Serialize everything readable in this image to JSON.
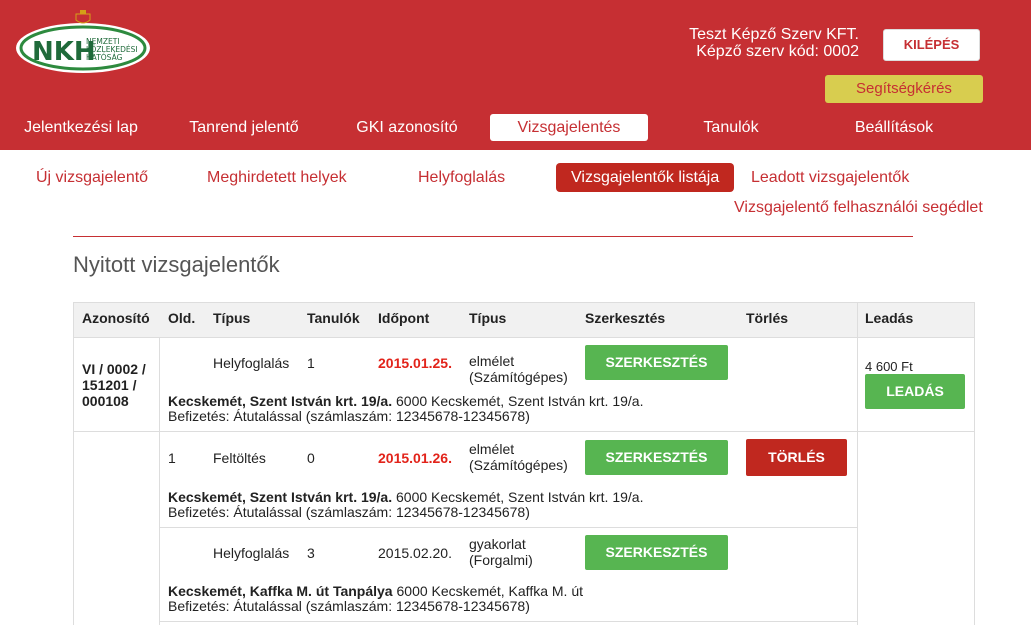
{
  "header": {
    "logo_text": "NKH",
    "logo_subtext": [
      "NEMZETI",
      "KÖZLEKEDÉSI",
      "HATÓSÁG"
    ],
    "org_name": "Teszt Képző Szerv KFT.",
    "org_code": "Képző szerv kód: 0002",
    "logout_label": "KILÉPÉS",
    "help_label": "Segítségkérés"
  },
  "main_nav": [
    "Jelentkezési lap",
    "Tanrend jelentő",
    "GKI azonosító",
    "Vizsgajelentés",
    "Tanulók",
    "Beállítások"
  ],
  "sub_nav": [
    "Új vizsgajelentő",
    "Meghirdetett helyek",
    "Helyfoglalás",
    "Vizsgajelentők listája",
    "Leadott vizsgajelentők",
    "Vizsgajelentő felhasználói segédlet"
  ],
  "page_title": "Nyitott vizsgajelentők",
  "table": {
    "headers": [
      "Azonosító",
      "Old.",
      "Típus",
      "Tanulók",
      "Időpont",
      "Típus",
      "Szerkesztés",
      "Törlés",
      "Leadás"
    ],
    "group_id": "VI / 0002 / 151201 / 000108",
    "price": "4 600 Ft",
    "submit_label": "LEADÁS",
    "rows": [
      {
        "page": "",
        "type": "Helyfoglalás",
        "students": "1",
        "date": "2015.01.25.",
        "exam_type": "elmélet (Számítógépes)",
        "edit": "SZERKESZTÉS",
        "delete": "",
        "location_bold": "Kecskemét, Szent István krt. 19/a.",
        "location": "6000 Kecskemét, Szent István krt. 19/a.",
        "payment": "Befizetés: Átutalással (számlaszám: 12345678-12345678)"
      },
      {
        "page": "1",
        "type": "Feltöltés",
        "students": "0",
        "date": "2015.01.26.",
        "exam_type": "elmélet (Számítógépes)",
        "edit": "SZERKESZTÉS",
        "delete": "TÖRLÉS",
        "location_bold": "Kecskemét, Szent István krt. 19/a.",
        "location": "6000 Kecskemét, Szent István krt. 19/a.",
        "payment": "Befizetés: Átutalással (számlaszám: 12345678-12345678)"
      },
      {
        "page": "",
        "type": "Helyfoglalás",
        "students": "3",
        "date": "2015.02.20.",
        "exam_type": "gyakorlat (Forgalmi)",
        "edit": "SZERKESZTÉS",
        "delete": "",
        "location_bold": "Kecskemét, Kaffka M. út Tanpálya",
        "location": "6000 Kecskemét, Kaffka M. út",
        "payment": "Befizetés: Átutalással (számlaszám: 12345678-12345678)"
      }
    ]
  },
  "colors": {
    "brand_red": "#c62f33",
    "help_yellow": "#d8cd4f",
    "button_green": "#57b551",
    "delete_red": "#c0281f",
    "date_red": "#e2231a"
  }
}
